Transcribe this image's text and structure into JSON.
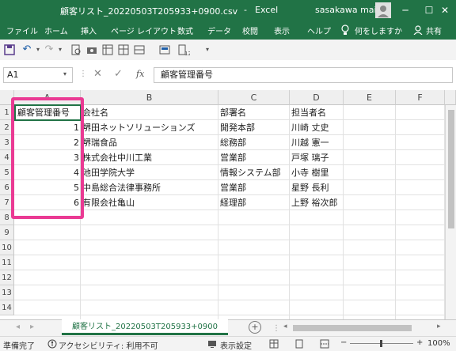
{
  "titlebar": {
    "document_title": "顧客リスト_20220503T205933+0900.csv",
    "separator": "-",
    "app_name": "Excel",
    "user": "sasakawa mai",
    "min_glyph": "─",
    "restore_glyph": "☐",
    "close_glyph": "✕"
  },
  "ribbon": {
    "tabs": [
      "ファイル",
      "ホーム",
      "挿入",
      "ページ レイアウト",
      "数式",
      "データ",
      "校閲",
      "表示",
      "ヘルプ"
    ],
    "search_label": "何をしますか",
    "share_label": "共有"
  },
  "formula_bar": {
    "name_box": "A1",
    "fx": "fx",
    "formula": "顧客管理番号"
  },
  "sheet": {
    "columns": [
      "A",
      "B",
      "C",
      "D",
      "E",
      "F"
    ],
    "row_numbers": [
      "1",
      "2",
      "3",
      "4",
      "5",
      "6",
      "7",
      "8",
      "9",
      "10",
      "11",
      "12",
      "13",
      "14"
    ],
    "rows": [
      [
        "顧客管理番号",
        "会社名",
        "部署名",
        "担当者名"
      ],
      [
        "1",
        "堺田ネットソリューションズ",
        "開発本部",
        "川崎 丈史"
      ],
      [
        "2",
        "堺瑞食品",
        "総務部",
        "川越 憲一"
      ],
      [
        "3",
        "株式会社中川工業",
        "営業部",
        "戸塚 璃子"
      ],
      [
        "4",
        "池田学院大学",
        "情報システム部",
        "小寺 樹里"
      ],
      [
        "5",
        "中島総合法律事務所",
        "営業部",
        "星野 長利"
      ],
      [
        "6",
        "有限会社亀山",
        "経理部",
        "上野 裕次郎"
      ]
    ],
    "tab_name": "顧客リスト_20220503T205933+0900"
  },
  "statusbar": {
    "ready": "準備完了",
    "accessibility": "アクセシビリティ: 利用不可",
    "display_settings": "表示設定",
    "zoom": "100%",
    "minus": "−",
    "plus": "+"
  },
  "colors": {
    "excel_green": "#217346",
    "highlight_pink": "#ea3a93"
  }
}
